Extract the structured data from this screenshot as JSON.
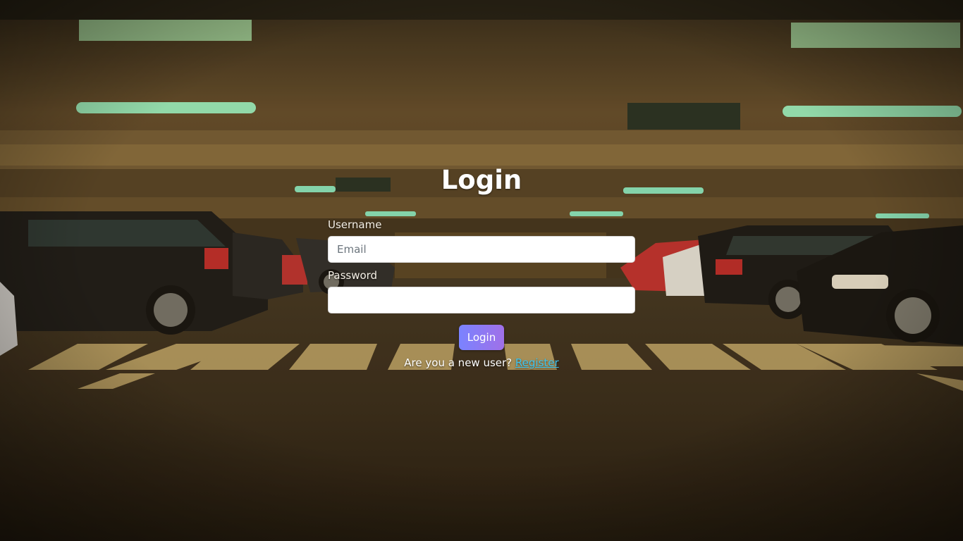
{
  "page": {
    "title": "Login"
  },
  "form": {
    "username_label": "Username",
    "username_placeholder": "Email",
    "username_value": "",
    "password_label": "Password",
    "password_placeholder": "",
    "password_value": "",
    "submit_label": "Login"
  },
  "register": {
    "prompt": "Are you a new user?",
    "link_label": "Register"
  },
  "colors": {
    "button_gradient_start": "#7a83ff",
    "button_gradient_end": "#a070e8",
    "link": "#3ec5f0",
    "text": "#ffffff"
  },
  "background": {
    "scene": "parking-garage-photo"
  }
}
